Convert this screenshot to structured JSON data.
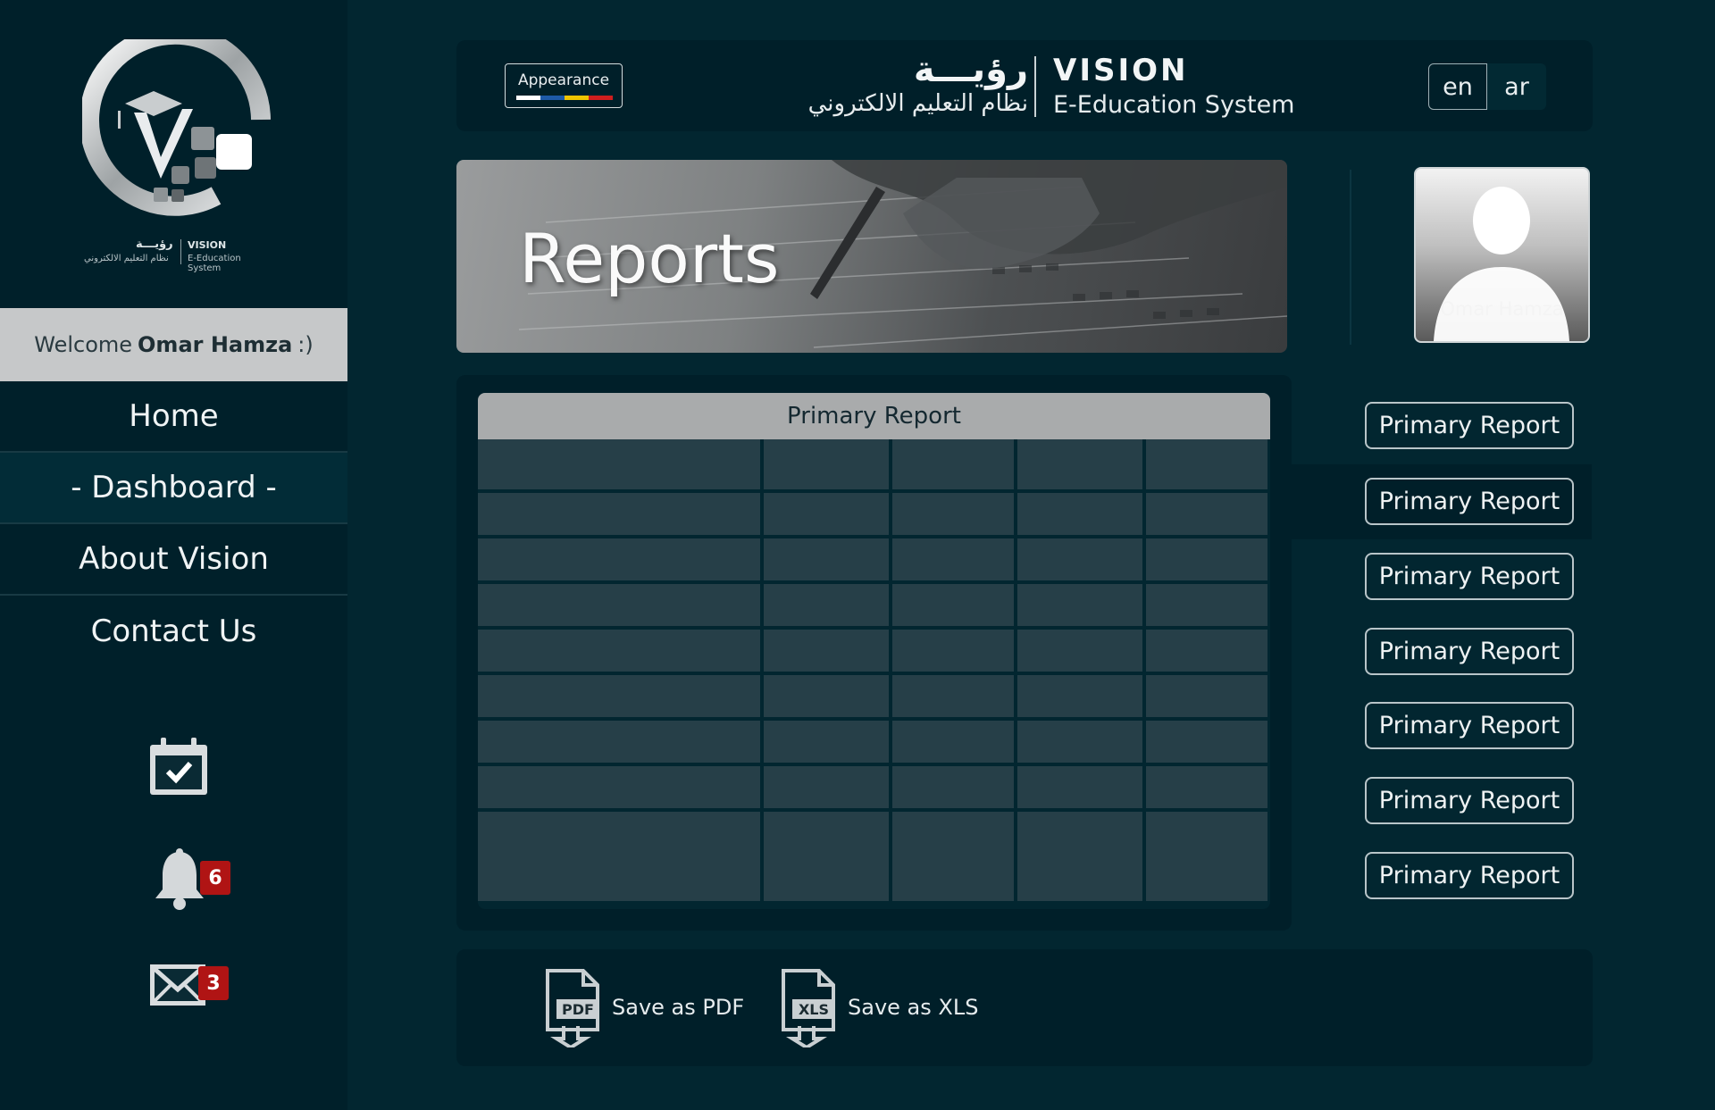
{
  "brand": {
    "name_ar": "رؤيـــة",
    "name_en": "VISION",
    "subtitle_ar": "نظام التعليم الالكتروني",
    "subtitle_en": "E-Education System"
  },
  "sidebar": {
    "welcome_prefix": "Welcome",
    "welcome_name": "Omar Hamza",
    "welcome_suffix": ":)",
    "nav": [
      {
        "label": "Home"
      },
      {
        "label": "- Dashboard -"
      },
      {
        "label": "About Vision"
      },
      {
        "label": "Contact Us"
      }
    ],
    "notifications_count": "6",
    "messages_count": "3"
  },
  "header": {
    "appearance_label": "Appearance",
    "appearance_colors": [
      "#ffffff",
      "#1e5aa8",
      "#f0c400",
      "#d01e1e"
    ],
    "lang_en": "en",
    "lang_ar": "ar"
  },
  "banner": {
    "title": "Reports"
  },
  "profile": {
    "name": "Omar Hamza"
  },
  "report_table": {
    "title": "Primary Report",
    "rows": 10,
    "columns": 5
  },
  "report_list": [
    {
      "label": "Primary Report"
    },
    {
      "label": "Primary Report"
    },
    {
      "label": "Primary Report"
    },
    {
      "label": "Primary Report"
    },
    {
      "label": "Primary Report"
    },
    {
      "label": "Primary Report"
    },
    {
      "label": "Primary Report"
    }
  ],
  "export": {
    "pdf_badge": "PDF",
    "pdf_label": "Save as PDF",
    "xls_badge": "XLS",
    "xls_label": "Save as XLS"
  },
  "colors": {
    "background": "#022630",
    "panel": "#001f29",
    "badge": "#b01414"
  }
}
